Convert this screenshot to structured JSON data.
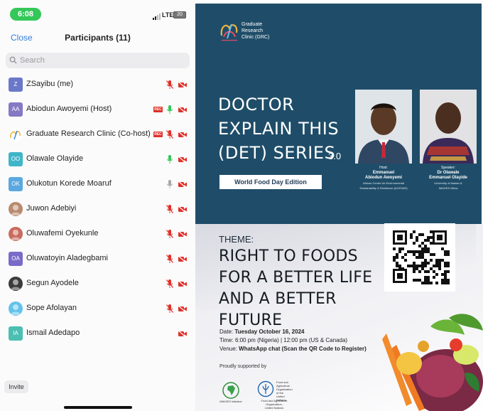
{
  "status_bar": {
    "time": "6:08",
    "network": "LTE",
    "battery": "20"
  },
  "nav": {
    "close_label": "Close",
    "title": "Participants (11)"
  },
  "search": {
    "placeholder": "Search"
  },
  "participants": [
    {
      "initials": "Z",
      "name": "ZSayibu (me)",
      "avatar_color": "#6b78c9",
      "recording": false,
      "mic": "muted",
      "video": "off"
    },
    {
      "initials": "AA",
      "name": "Abiodun Awoyemi (Host)",
      "avatar_color": "#8579c4",
      "recording": true,
      "mic": "on",
      "video": "off"
    },
    {
      "initials": "",
      "name": "Graduate Research Clinic (Co-host)",
      "avatar_color": "#ffffff",
      "recording": true,
      "mic": "muted",
      "video": "off"
    },
    {
      "initials": "OO",
      "name": "Olawale Olayide",
      "avatar_color": "#3fb5c9",
      "recording": false,
      "mic": "on",
      "video": "off"
    },
    {
      "initials": "OK",
      "name": "Olukotun Korede Moaruf",
      "avatar_color": "#5aa8e0",
      "recording": false,
      "mic": "idle",
      "video": "off"
    },
    {
      "initials": "",
      "name": "Juwon Adebiyi",
      "avatar_color": "#b98a6f",
      "recording": false,
      "mic": "muted",
      "video": "off"
    },
    {
      "initials": "",
      "name": "Oluwafemi Oyekunle",
      "avatar_color": "#c96b5e",
      "recording": false,
      "mic": "muted",
      "video": "off"
    },
    {
      "initials": "OA",
      "name": "Oluwatoyin  Aladegbami",
      "avatar_color": "#7a6bc9",
      "recording": false,
      "mic": "muted",
      "video": "off"
    },
    {
      "initials": "",
      "name": "Segun Ayodele",
      "avatar_color": "#3b3b3b",
      "recording": false,
      "mic": "muted",
      "video": "off"
    },
    {
      "initials": "",
      "name": "Sope Afolayan",
      "avatar_color": "#63c3ea",
      "recording": false,
      "mic": "muted",
      "video": "off"
    },
    {
      "initials": "IA",
      "name": "Ismail Adedapo",
      "avatar_color": "#4bbfb2",
      "recording": false,
      "mic": "none",
      "video": "off"
    }
  ],
  "invite_label": "Invite",
  "poster": {
    "org": "Graduate\nResearch\nClinic (GRC)",
    "title": "DOCTOR\nEXPLAIN THIS\n(DET) SERIES",
    "version": "3.0",
    "edition": "World Food Day Edition",
    "host": {
      "role": "Host:",
      "name": "Emmanuel\nAbiodun Awoyemi",
      "affiliation": "African Centre for Environmental\nSustainability & Resilience (ACESAR)"
    },
    "speaker": {
      "role": "Speaker:",
      "name": "Dr Olawale\nEmmanuel Olayide",
      "affiliation": "University of Ibadan &\nIMAGES Africa"
    },
    "theme_label": "THEME:",
    "theme": "RIGHT TO FOODS\nFOR A BETTER LIFE\nAND A BETTER FUTURE",
    "date_label": "Date:",
    "date": "Tuesday October 16, 2024",
    "time_label": "Time:",
    "time": "6:00 pm (Nigeria) | 12:00 pm (US & Canada)",
    "venue_label": "Venue:",
    "venue": "WhatsApp chat (Scan the QR Code to Register)",
    "supported_by": "Proudly supported by",
    "sponsor1": "IMAGES Initiative",
    "sponsor2_full": "Food and Agriculture\nOrganization of the\nUnited Nations",
    "sponsor2_short": "Food and Agriculture Organization,\nUnited Nations"
  },
  "colors": {
    "accent": "#2f7de1",
    "poster_navy": "#1f4d69",
    "mic_on": "#34c759",
    "recording": "#e0302a"
  }
}
